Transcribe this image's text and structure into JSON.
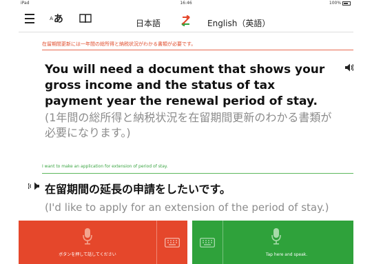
{
  "status_bar": {
    "carrier": "iPad",
    "time": "16:46",
    "right": "100%"
  },
  "toolbar": {
    "hiragana_label": "あ",
    "hiragana_small": "A",
    "source_language": "日本語",
    "target_language": "English（英語）"
  },
  "upper": {
    "jp_caption": "在留期間更新には一年間の総所得と納税状況がわかる書類が必要です。",
    "english_text": "You will need a document that shows your gross income and the status of tax payment year the renewal period of stay.",
    "japanese_back": "(1年間の総所得と納税状況を在留期間更新のわかる書類が必要になります。)"
  },
  "lower": {
    "en_caption": "I want to make an application for extension of period of stay.",
    "japanese_text": "在留期間の延長の申請をしたいです。",
    "english_back": "(I'd like to apply for an extension of the period of stay.)"
  },
  "buttons": {
    "jp_speak_label": "ボタンを押して話してください",
    "en_speak_label": "Tap here and speak."
  },
  "colors": {
    "jp_accent": "#e5472b",
    "en_accent": "#2fa23b"
  }
}
